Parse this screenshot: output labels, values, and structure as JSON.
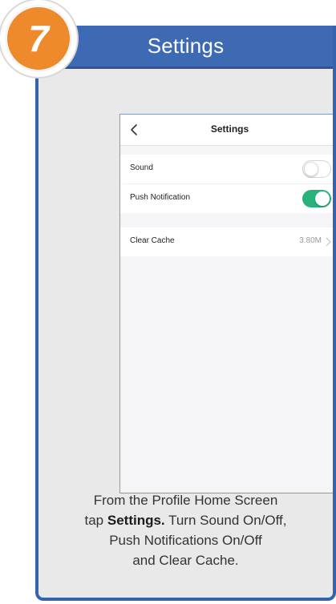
{
  "step": {
    "number": "7",
    "title": "Settings"
  },
  "phone": {
    "nav_title": "Settings",
    "rows": {
      "sound": {
        "label": "Sound",
        "on": false
      },
      "push": {
        "label": "Push Notification",
        "on": true
      },
      "cache": {
        "label": "Clear Cache",
        "value": "3.80M"
      }
    }
  },
  "caption": {
    "line1": "From the Profile Home Screen",
    "line2_prefix": "tap ",
    "line2_bold": "Settings.",
    "line2_suffix": " Turn Sound On/Off,",
    "line3": "Push Notifications On/Off",
    "line4": "and Clear Cache."
  },
  "colors": {
    "header_blue": "#3e69b3",
    "badge_orange": "#ee8a2c",
    "toggle_green": "#27b37b"
  }
}
